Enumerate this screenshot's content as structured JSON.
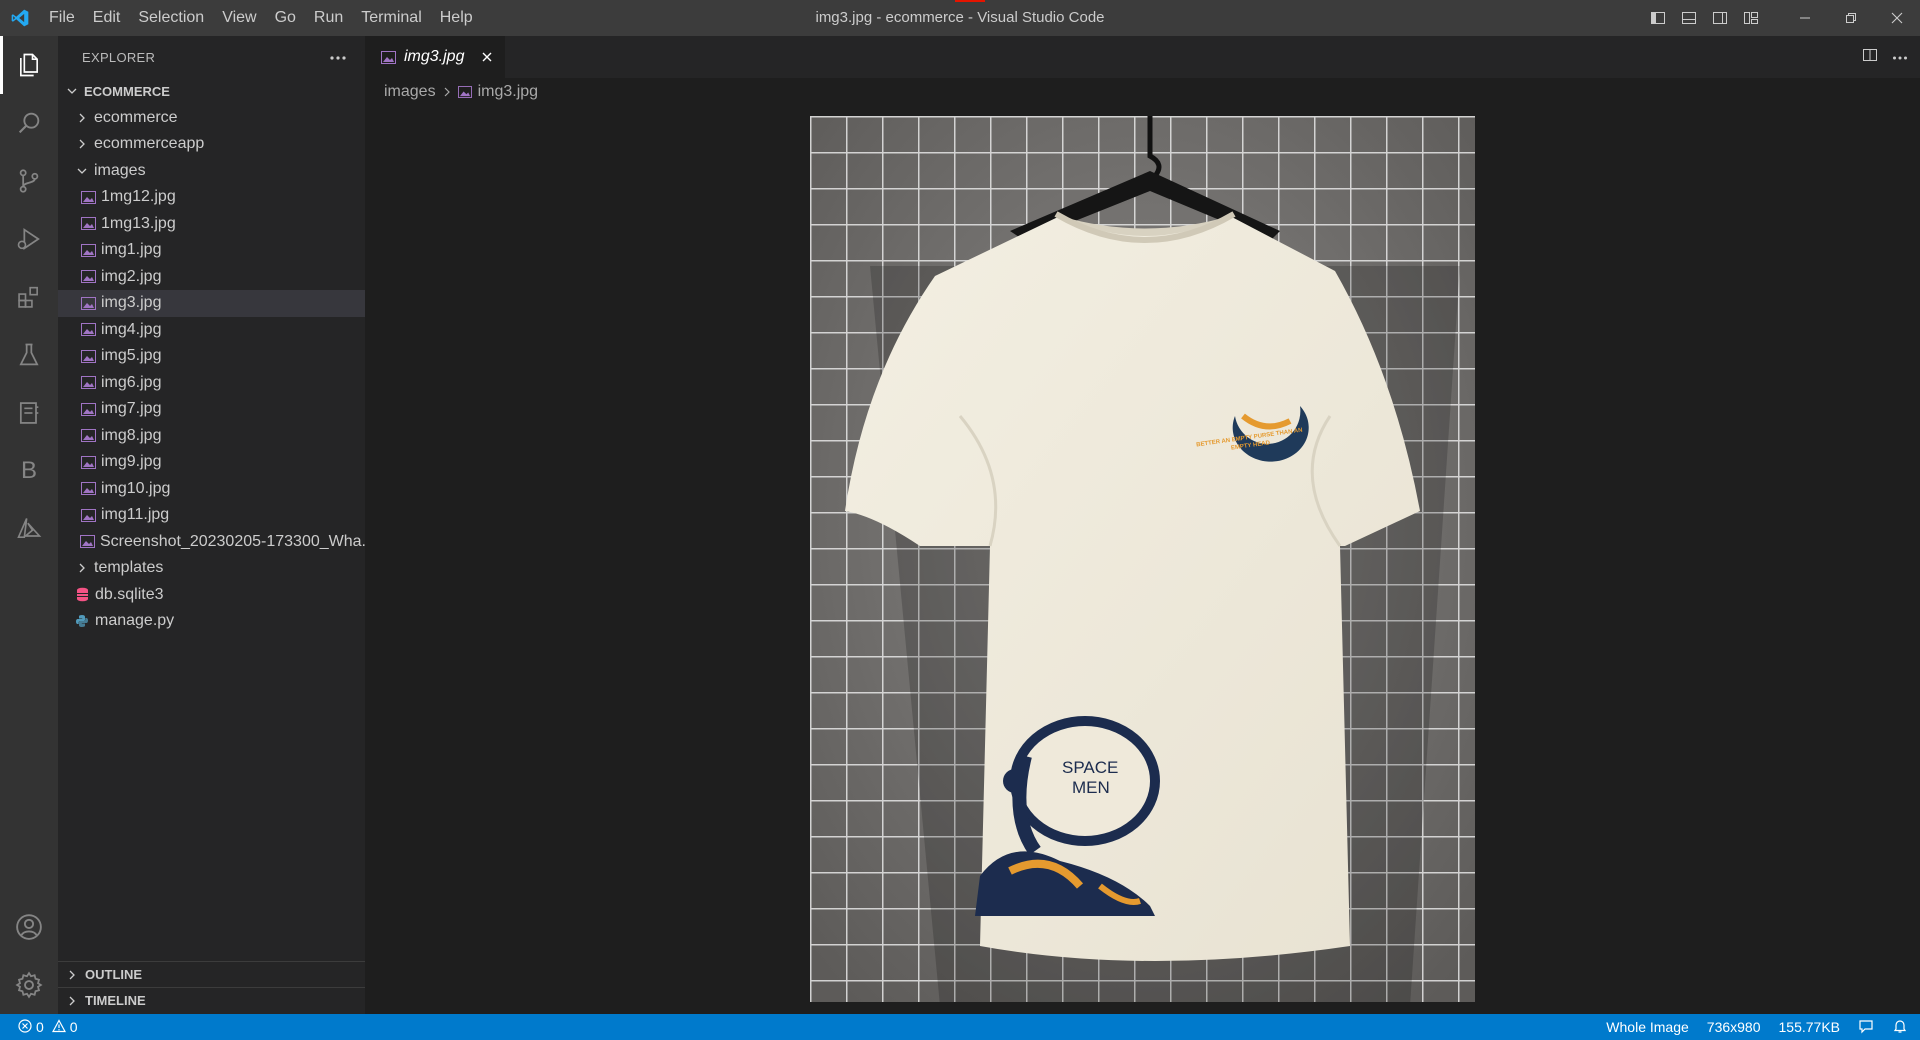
{
  "window": {
    "title": "img3.jpg - ecommerce - Visual Studio Code"
  },
  "menu": [
    "File",
    "Edit",
    "Selection",
    "View",
    "Go",
    "Run",
    "Terminal",
    "Help"
  ],
  "activity_bar": {
    "top": [
      "explorer-icon",
      "search-icon",
      "source-control-icon",
      "run-debug-icon",
      "extensions-icon",
      "testing-icon",
      "notebook-icon",
      "b-icon",
      "azure-icon"
    ],
    "b_letter": "B",
    "bottom": [
      "account-icon",
      "settings-gear-icon"
    ]
  },
  "sidebar": {
    "title": "EXPLORER",
    "root": "ECOMMERCE",
    "tree": [
      {
        "label": "ecommerce",
        "type": "folder",
        "expanded": false,
        "depth": 1
      },
      {
        "label": "ecommerceapp",
        "type": "folder",
        "expanded": false,
        "depth": 1
      },
      {
        "label": "images",
        "type": "folder",
        "expanded": true,
        "depth": 1
      },
      {
        "label": "1mg12.jpg",
        "type": "image",
        "depth": 2
      },
      {
        "label": "1mg13.jpg",
        "type": "image",
        "depth": 2
      },
      {
        "label": "img1.jpg",
        "type": "image",
        "depth": 2
      },
      {
        "label": "img2.jpg",
        "type": "image",
        "depth": 2
      },
      {
        "label": "img3.jpg",
        "type": "image",
        "depth": 2,
        "selected": true
      },
      {
        "label": "img4.jpg",
        "type": "image",
        "depth": 2
      },
      {
        "label": "img5.jpg",
        "type": "image",
        "depth": 2
      },
      {
        "label": "img6.jpg",
        "type": "image",
        "depth": 2
      },
      {
        "label": "img7.jpg",
        "type": "image",
        "depth": 2
      },
      {
        "label": "img8.jpg",
        "type": "image",
        "depth": 2
      },
      {
        "label": "img9.jpg",
        "type": "image",
        "depth": 2
      },
      {
        "label": "img10.jpg",
        "type": "image",
        "depth": 2
      },
      {
        "label": "img11.jpg",
        "type": "image",
        "depth": 2
      },
      {
        "label": "Screenshot_20230205-173300_Wha...",
        "type": "image",
        "depth": 2
      },
      {
        "label": "templates",
        "type": "folder",
        "expanded": false,
        "depth": 1
      },
      {
        "label": "db.sqlite3",
        "type": "database",
        "depth": 1
      },
      {
        "label": "manage.py",
        "type": "python",
        "depth": 1
      }
    ],
    "sections": [
      "OUTLINE",
      "TIMELINE"
    ]
  },
  "editor": {
    "tab": {
      "label": "img3.jpg"
    },
    "breadcrumb": [
      "images",
      "img3.jpg"
    ],
    "image_text": {
      "chest_print": "BETTER AN EMPTY PURSE THAN AN EMPTY HEAD",
      "back_print_line1": "SPACE",
      "back_print_line2": "MEN"
    }
  },
  "statusbar": {
    "errors": "0",
    "warnings": "0",
    "zoom_mode": "Whole Image",
    "dimensions": "736x980",
    "size": "155.77KB"
  },
  "colors": {
    "accent": "#007acc",
    "image_icon": "#a074c4",
    "db_icon": "#f55385",
    "python_icon": "#519aba"
  }
}
